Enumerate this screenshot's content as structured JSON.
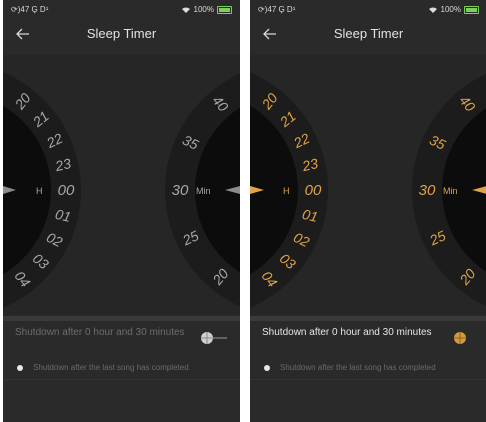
{
  "statusbar": {
    "left": "⟳)47 G̙ D¹",
    "battery": "100%"
  },
  "header": {
    "title": "Sleep Timer"
  },
  "hours": {
    "label": "H",
    "labels": [
      "20",
      "21",
      "22",
      "23",
      "00",
      "01",
      "02",
      "03",
      "04"
    ]
  },
  "minutes": {
    "label": "Min",
    "labels": [
      "40",
      "35",
      "30",
      "25",
      "20"
    ]
  },
  "shutdown_text": "Shutdown after 0 hour and 30 minutes",
  "option_text": "Shutdown after the last song has completed",
  "colors": {
    "inactive_text": "#a8a8a8",
    "active_text": "#e0a348",
    "background": "#2a2a2a",
    "ring": "#141414",
    "accent": "#d69a3e"
  },
  "icons": [
    "back-arrow-icon",
    "wifi-icon",
    "battery-icon",
    "toggle-knob-icon",
    "radio-dot-icon"
  ]
}
